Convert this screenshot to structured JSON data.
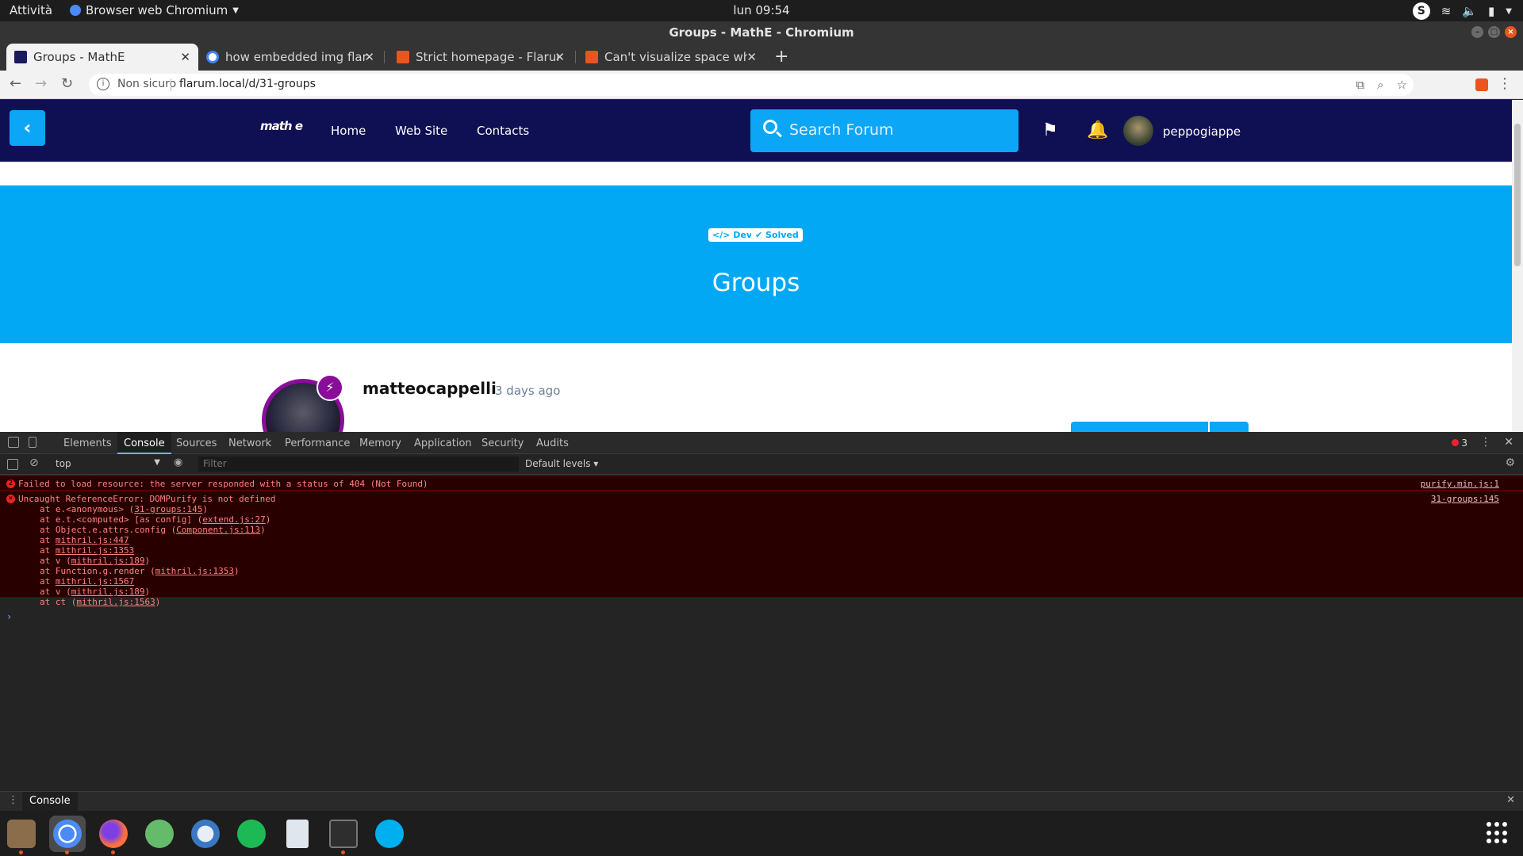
{
  "system": {
    "activities": "Attività",
    "app_menu": "Browser web Chromium",
    "clock": "lun 09:54"
  },
  "window": {
    "title": "Groups - MathE - Chromium"
  },
  "tabs": [
    {
      "title": "Groups - MathE",
      "favicon_color": "#1a1a60"
    },
    {
      "title": "how embedded img flarum",
      "favicon_color": "#4285f4"
    },
    {
      "title": "Strict homepage - Flarum",
      "favicon_color": "#e9541f"
    },
    {
      "title": "Can't visualize space whe",
      "favicon_color": "#e9541f"
    }
  ],
  "toolbar": {
    "security_label": "Non sicuro",
    "url": "flarum.local/d/31-groups"
  },
  "forum": {
    "logo_text": "math e",
    "nav": [
      "Home",
      "Web Site",
      "Contacts"
    ],
    "search_placeholder": "Search Forum",
    "username": "peppogiappe",
    "header_color": "#0f0f54",
    "accent_color": "#0ba6f6"
  },
  "discussion": {
    "tags": [
      "</> Dev",
      "✔ Solved"
    ],
    "title": "Groups",
    "author": "matteocappelli",
    "time": "3 days ago"
  },
  "devtools": {
    "tabs": [
      "Elements",
      "Console",
      "Sources",
      "Network",
      "Performance",
      "Memory",
      "Application",
      "Security",
      "Audits"
    ],
    "active_tab": "Console",
    "error_count": "3",
    "context": "top",
    "filter_placeholder": "Filter",
    "levels": "Default levels",
    "drawer_tab": "Console",
    "errors": [
      {
        "message": "Failed to load resource: the server responded with a status of 404 (Not Found)",
        "source": "purify.min.js:1"
      },
      {
        "message": "Uncaught ReferenceError: DOMPurify is not defined",
        "source": "31-groups:145",
        "stack": [
          {
            "pre": "at e.<anonymous> (",
            "link": "31-groups:145",
            "post": ")"
          },
          {
            "pre": "at e.t.<computed> [as config] (",
            "link": "extend.js:27",
            "post": ")"
          },
          {
            "pre": "at Object.e.attrs.config (",
            "link": "Component.js:113",
            "post": ")"
          },
          {
            "pre": "at ",
            "link": "mithril.js:447",
            "post": ""
          },
          {
            "pre": "at ",
            "link": "mithril.js:1353",
            "post": ""
          },
          {
            "pre": "at v (",
            "link": "mithril.js:189",
            "post": ")"
          },
          {
            "pre": "at Function.g.render (",
            "link": "mithril.js:1353",
            "post": ")"
          },
          {
            "pre": "at ",
            "link": "mithril.js:1567",
            "post": ""
          },
          {
            "pre": "at v (",
            "link": "mithril.js:189",
            "post": ")"
          },
          {
            "pre": "at ct (",
            "link": "mithril.js:1563",
            "post": ")"
          }
        ]
      }
    ]
  },
  "dock": [
    {
      "name": "files",
      "color": "#8a6d4b"
    },
    {
      "name": "chromium",
      "color": "#4c8bf5"
    },
    {
      "name": "firefox",
      "color": "#ff7139"
    },
    {
      "name": "atom",
      "color": "#66bb6a"
    },
    {
      "name": "thunderbird",
      "color": "#3b78c4"
    },
    {
      "name": "spotify",
      "color": "#1db954"
    },
    {
      "name": "text-editor",
      "color": "#dfe6ee"
    },
    {
      "name": "terminal",
      "color": "#2e2e2e"
    },
    {
      "name": "skype",
      "color": "#00aff0"
    }
  ]
}
